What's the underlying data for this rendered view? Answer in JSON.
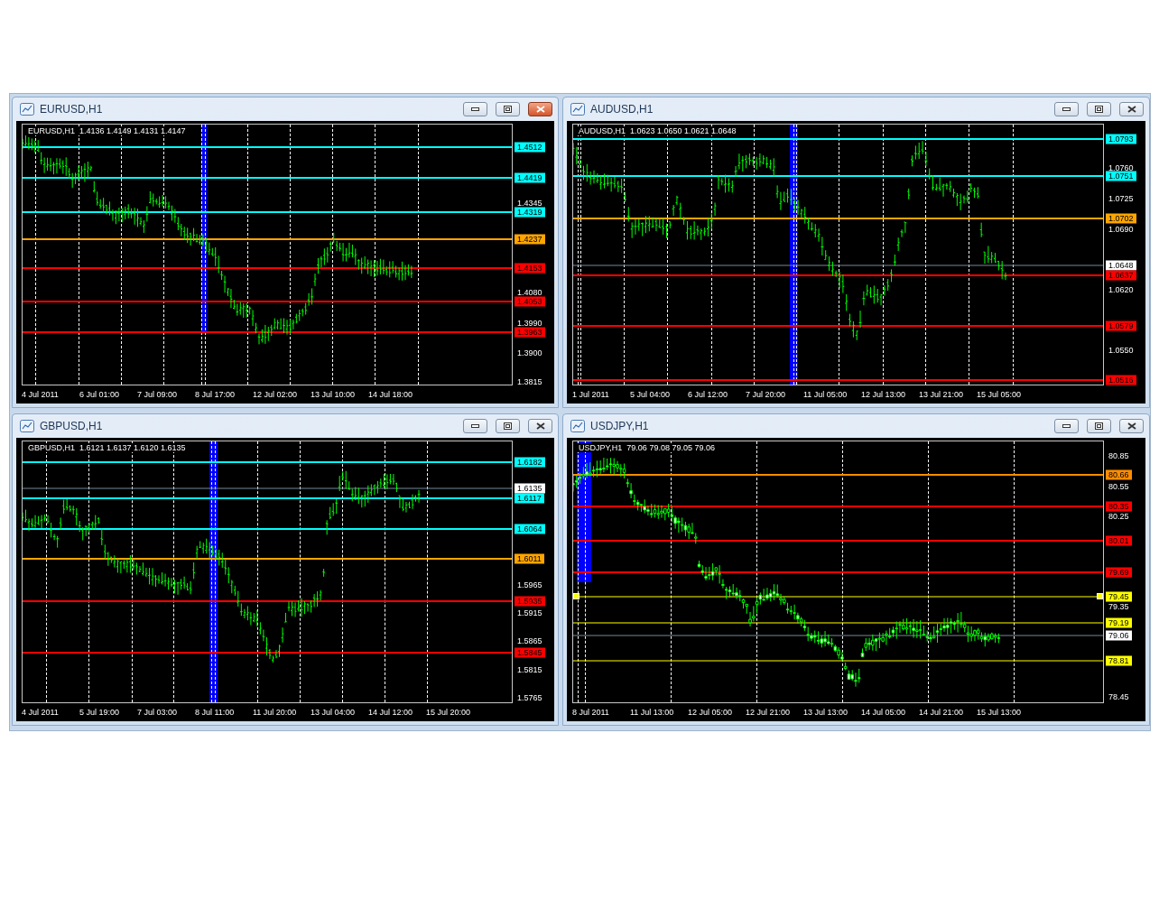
{
  "windows": [
    {
      "title": "EURUSD,H1",
      "active": true,
      "kind": "bars",
      "header": "EURUSD,H1  1.4136 1.4149 1.4131 1.4147",
      "price_ticks": [
        "1.4345",
        "1.4080",
        "1.3990",
        "1.3900",
        "1.3815"
      ],
      "levels": [
        {
          "label": "1.4512",
          "color": "#00ffff",
          "kind": "line",
          "selected": false
        },
        {
          "label": "1.4419",
          "color": "#00ffff",
          "kind": "line",
          "selected": false
        },
        {
          "label": "1.4319",
          "color": "#00ffff",
          "kind": "line",
          "selected": false
        },
        {
          "label": "1.4237",
          "color": "#ffa500",
          "kind": "line",
          "selected": false
        },
        {
          "label": "1.4153",
          "color": "#ff0000",
          "kind": "line",
          "selected": false
        },
        {
          "label": "1.4053",
          "color": "#ff0000",
          "kind": "line",
          "selected": false
        },
        {
          "label": "1.3963",
          "color": "#ff0000",
          "kind": "line",
          "selected": false
        }
      ],
      "time_labels": [
        "4 Jul 2011",
        "6 Jul 01:00",
        "7 Jul 09:00",
        "8 Jul 17:00",
        "12 Jul 02:00",
        "13 Jul 10:00",
        "14 Jul 18:00"
      ]
    },
    {
      "title": "AUDUSD,H1",
      "active": false,
      "kind": "bars",
      "header": "AUDUSD,H1  1.0623 1.0650 1.0621 1.0648",
      "price_ticks": [
        "1.0760",
        "1.0725",
        "1.0690",
        "1.0620",
        "1.0550"
      ],
      "levels": [
        {
          "label": "1.0793",
          "color": "#00ffff",
          "kind": "line",
          "selected": false
        },
        {
          "label": "1.0751",
          "color": "#00ffff",
          "kind": "line",
          "selected": false
        },
        {
          "label": "1.0702",
          "color": "#ffa500",
          "kind": "line",
          "selected": false
        },
        {
          "label": "1.0648",
          "color": "#ffffff",
          "kind": "bid",
          "selected": false
        },
        {
          "label": "1.0637",
          "color": "#ff0000",
          "kind": "line",
          "selected": false
        },
        {
          "label": "1.0579",
          "color": "#ff0000",
          "kind": "line",
          "selected": false
        },
        {
          "label": "1.0516",
          "color": "#ff0000",
          "kind": "line",
          "selected": false
        }
      ],
      "time_labels": [
        "1 Jul 2011",
        "5 Jul 04:00",
        "6 Jul 12:00",
        "7 Jul 20:00",
        "11 Jul 05:00",
        "12 Jul 13:00",
        "13 Jul 21:00",
        "15 Jul 05:00"
      ]
    },
    {
      "title": "GBPUSD,H1",
      "active": false,
      "kind": "bars",
      "header": "GBPUSD,H1  1.6121 1.6137 1.6120 1.6135",
      "price_ticks": [
        "1.5965",
        "1.5915",
        "1.5865",
        "1.5815",
        "1.5765"
      ],
      "levels": [
        {
          "label": "1.6182",
          "color": "#00ffff",
          "kind": "line",
          "selected": false
        },
        {
          "label": "1.6135",
          "color": "#ffffff",
          "kind": "bid",
          "selected": false
        },
        {
          "label": "1.6117",
          "color": "#00ffff",
          "kind": "line",
          "selected": false
        },
        {
          "label": "1.6064",
          "color": "#00ffff",
          "kind": "line",
          "selected": false
        },
        {
          "label": "1.6011",
          "color": "#ffa500",
          "kind": "line",
          "selected": false
        },
        {
          "label": "1.5935",
          "color": "#ff0000",
          "kind": "line",
          "selected": false
        },
        {
          "label": "1.5845",
          "color": "#ff0000",
          "kind": "line",
          "selected": false
        }
      ],
      "time_labels": [
        "4 Jul 2011",
        "5 Jul 19:00",
        "7 Jul 03:00",
        "8 Jul 11:00",
        "11 Jul 20:00",
        "13 Jul 04:00",
        "14 Jul 12:00",
        "15 Jul 20:00"
      ]
    },
    {
      "title": "USDJPY,H1",
      "active": false,
      "kind": "candles",
      "header": "USDJPY,H1  79.06 79.08 79.05 79.06",
      "price_ticks": [
        "80.85",
        "80.55",
        "80.25",
        "79.35",
        "78.45"
      ],
      "levels": [
        {
          "label": "80.66",
          "color": "#ff8c00",
          "kind": "line",
          "selected": false
        },
        {
          "label": "80.35",
          "color": "#ff0000",
          "kind": "line",
          "selected": false
        },
        {
          "label": "80.01",
          "color": "#ff0000",
          "kind": "line",
          "selected": false
        },
        {
          "label": "79.69",
          "color": "#ff0000",
          "kind": "line",
          "selected": false
        },
        {
          "label": "79.45",
          "color": "#ffff00",
          "kind": "thin",
          "selected": true
        },
        {
          "label": "79.19",
          "color": "#ffff00",
          "kind": "thin",
          "selected": false
        },
        {
          "label": "79.06",
          "color": "#ffffff",
          "kind": "bid",
          "selected": false
        },
        {
          "label": "78.81",
          "color": "#ffff00",
          "kind": "thin",
          "selected": false
        }
      ],
      "time_labels": [
        "8 Jul 2011",
        "11 Jul 13:00",
        "12 Jul 05:00",
        "12 Jul 21:00",
        "13 Jul 13:00",
        "14 Jul 05:00",
        "14 Jul 21:00",
        "15 Jul 13:00"
      ]
    }
  ]
}
